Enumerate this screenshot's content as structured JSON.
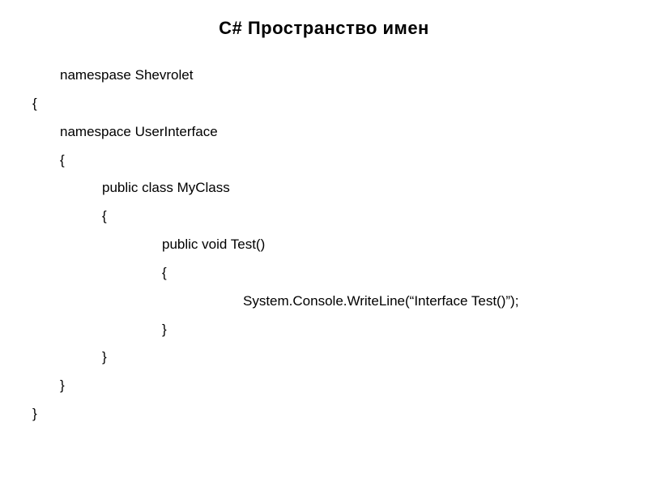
{
  "title": "C#  Пространство имен",
  "code": {
    "lines": [
      {
        "indent": 1,
        "text": "namespase Shevrolet"
      },
      {
        "indent": 0,
        "text": "{"
      },
      {
        "indent": 1,
        "text": "namespace UserInterface"
      },
      {
        "indent": 1,
        "text": "{"
      },
      {
        "indent": 2,
        "text": "public class MyClass"
      },
      {
        "indent": 2,
        "text": "{"
      },
      {
        "indent": 3,
        "text": "public void Test()"
      },
      {
        "indent": 3,
        "text": "{"
      },
      {
        "indent": 4,
        "text": "System.Console.WriteLine(“Interface Test()”);"
      },
      {
        "indent": 3,
        "text": "}"
      },
      {
        "indent": 2,
        "text": "}"
      },
      {
        "indent": 1,
        "text": "}"
      },
      {
        "indent": 0,
        "text": "}"
      }
    ]
  }
}
